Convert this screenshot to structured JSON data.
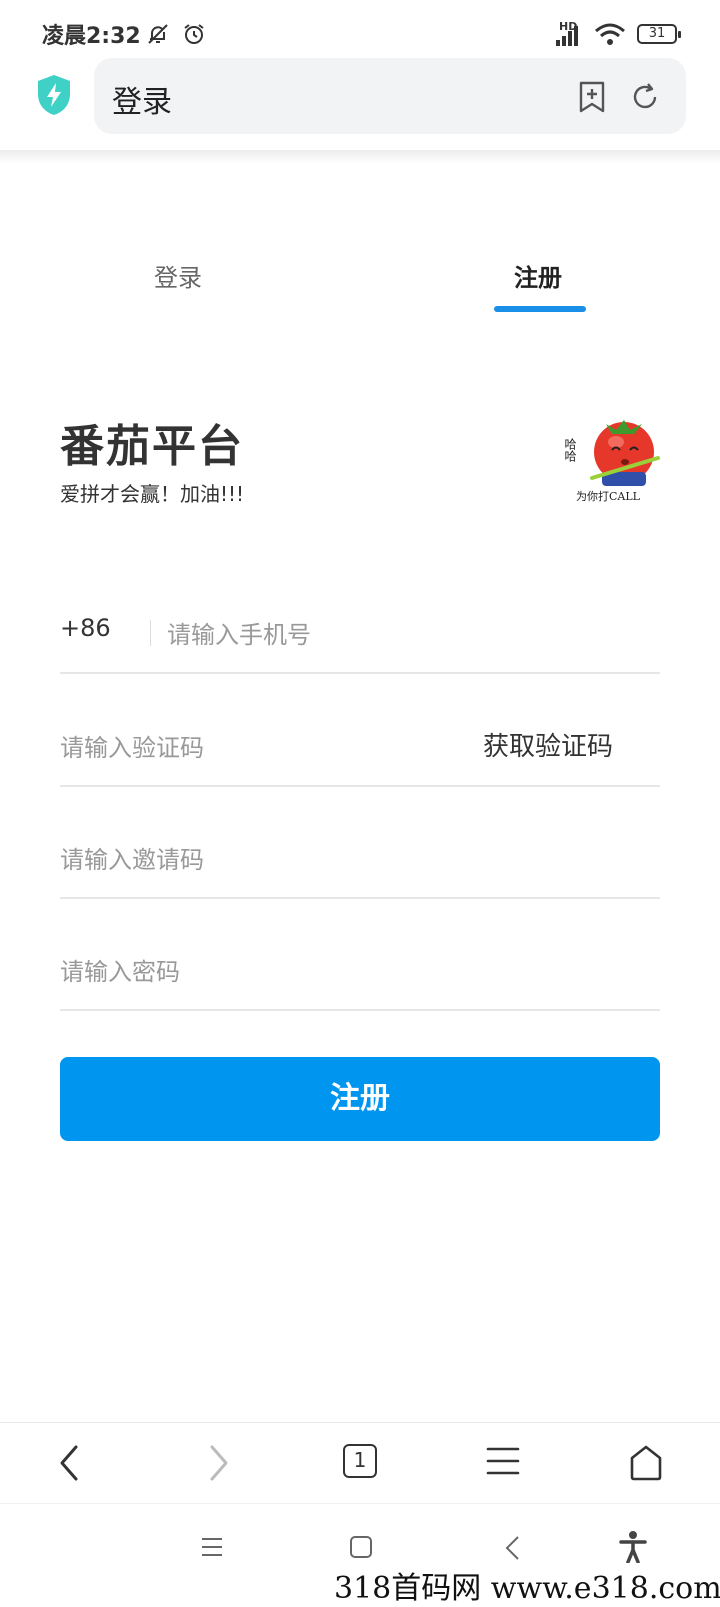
{
  "status_bar": {
    "time": "凌晨2:32",
    "network": "HD",
    "battery": "31",
    "icons": [
      "bell-off-icon",
      "alarm-icon",
      "signal-icon",
      "wifi-icon",
      "battery-icon"
    ]
  },
  "browser": {
    "page_title": "登录",
    "icons": [
      "shield-bolt-icon",
      "bookmark-add-icon",
      "refresh-icon"
    ]
  },
  "tabs": [
    {
      "label": "登录",
      "active": false
    },
    {
      "label": "注册",
      "active": true
    }
  ],
  "brand": {
    "title": "番茄平台",
    "subtitle": "爱拼才会赢！加油!!!",
    "mascot_caption": "为你打CALL",
    "mascot_side_text": "哈哈"
  },
  "form": {
    "country_code": "+86",
    "phone_placeholder": "请输入手机号",
    "code_placeholder": "请输入验证码",
    "get_code_label": "获取验证码",
    "invite_placeholder": "请输入邀请码",
    "password_placeholder": "请输入密码",
    "submit_label": "注册"
  },
  "bottom_nav": {
    "tab_count": "1",
    "icons": [
      "back-icon",
      "forward-icon",
      "tabs-icon",
      "menu-icon",
      "home-icon"
    ]
  },
  "system_nav": {
    "icons": [
      "recent-apps-icon",
      "home-square-icon",
      "system-back-icon",
      "accessibility-icon"
    ]
  },
  "watermark": "318首码网 www.e318.com",
  "colors": {
    "accent": "#0095ef",
    "tab_indicator": "#1a8fe8",
    "shield": "#3fd0c6"
  }
}
